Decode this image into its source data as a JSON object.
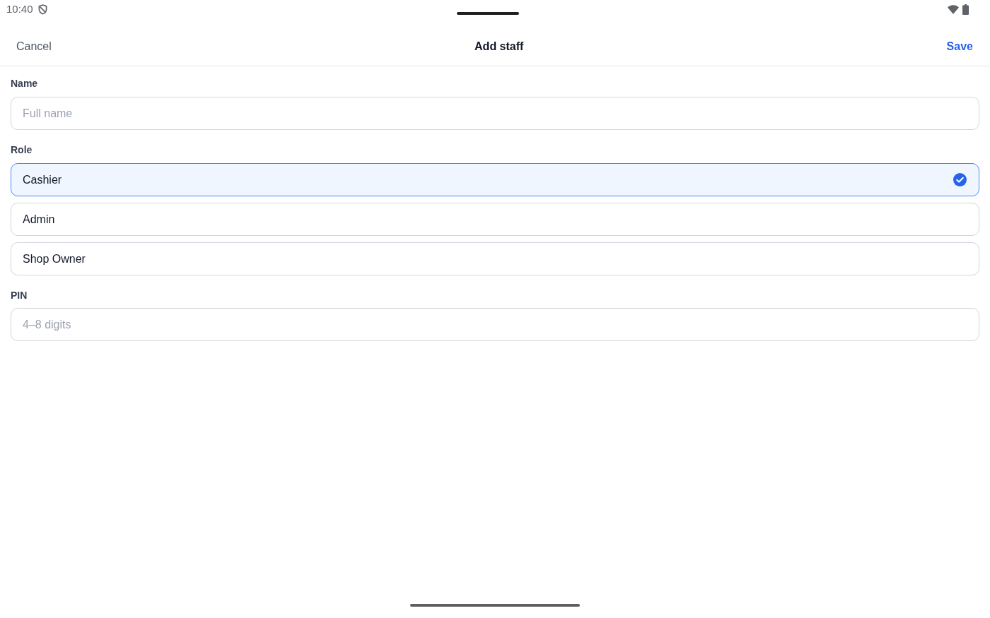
{
  "status_bar": {
    "time": "10:40"
  },
  "header": {
    "cancel": "Cancel",
    "title": "Add staff",
    "save": "Save"
  },
  "name_field": {
    "label": "Name",
    "placeholder": "Full name"
  },
  "role": {
    "label": "Role",
    "options": [
      {
        "label": "Cashier",
        "selected": true
      },
      {
        "label": "Admin",
        "selected": false
      },
      {
        "label": "Shop Owner",
        "selected": false
      }
    ]
  },
  "pin_field": {
    "label": "PIN",
    "placeholder": "4–8 digits"
  }
}
